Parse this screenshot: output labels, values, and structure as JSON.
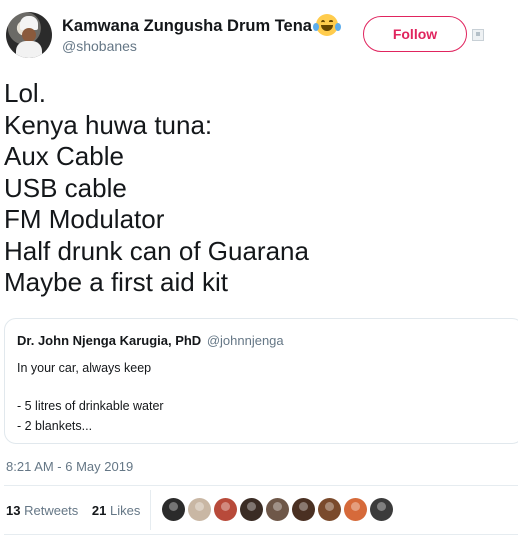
{
  "author": {
    "display_name": "Kamwana Zungusha Drum Tena",
    "emoji_icon": "face-with-tears-of-joy-icon",
    "handle": "@shobanes"
  },
  "follow_button": {
    "label": "Follow",
    "color": "#e0245e"
  },
  "tweet": {
    "lines": [
      "Lol.",
      "Kenya huwa tuna:",
      "Aux Cable",
      "USB cable",
      "FM Modulator",
      "Half drunk can of Guarana",
      "Maybe a first aid kit"
    ]
  },
  "quoted_tweet": {
    "name": "Dr. John Njenga Karugia, PhD",
    "handle": "@johnnjenga",
    "line1": "In your car, always keep",
    "line2": "- 5 litres of drinkable water",
    "line3": "- 2 blankets..."
  },
  "timestamp": "8:21 AM - 6 May 2019",
  "stats": {
    "retweets_count": "13",
    "retweets_label": "Retweets",
    "likes_count": "21",
    "likes_label": "Likes"
  },
  "likers": [
    {
      "color": "#2b2b2b"
    },
    {
      "color": "#c9b7a4"
    },
    {
      "color": "#b84a3a"
    },
    {
      "color": "#3a2c24"
    },
    {
      "color": "#6e5748"
    },
    {
      "color": "#4a3022"
    },
    {
      "color": "#7a4a2c"
    },
    {
      "color": "#d66a3a"
    },
    {
      "color": "#3b3b3b"
    }
  ]
}
